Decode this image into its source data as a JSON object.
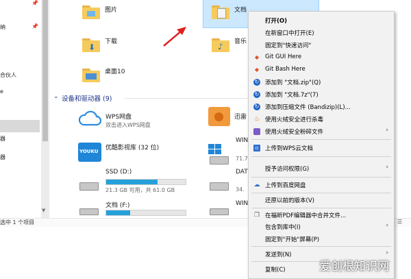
{
  "nav": {
    "items": [
      "纳",
      "合伙人",
      "e",
      "器",
      "器"
    ]
  },
  "content": {
    "folders": [
      "图片",
      "下载",
      "桌面10"
    ],
    "selected_file": "文档",
    "music_label": "音乐",
    "section_title": "设备和驱动器 (9)",
    "wps": {
      "name": "WPS网盘",
      "desc": "双击进入WPS网盘"
    },
    "youku": {
      "name": "优酷影视库 (32 位)",
      "logo": "YOUKU"
    },
    "xunlei": "迅雷",
    "ssd": {
      "name": "SSD (D:)",
      "free": "21.3 GB 可用，共 61.0 GB",
      "used_fraction": 0.65
    },
    "docs": {
      "name": "文档 (F:)",
      "used_fraction": 0.3
    },
    "right_cut": [
      "WIN",
      "71.7",
      "DAT",
      "34.",
      "WIN"
    ]
  },
  "status": {
    "text": "选中 1 个项目"
  },
  "menu": {
    "items": [
      {
        "label": "打开(O)",
        "bold": true
      },
      {
        "label": "在新窗口中打开(E)"
      },
      {
        "label": "固定到\"快速访问\""
      },
      {
        "label": "Git GUI Here",
        "icon": "git-gui-icon"
      },
      {
        "label": "Git Bash Here",
        "icon": "git-bash-icon"
      },
      {
        "label": "添加到 \"文档.zip\"(Q)",
        "icon": "bandizip-icon"
      },
      {
        "label": "添加到 \"文档.7z\"(7)",
        "icon": "bandizip-icon"
      },
      {
        "label": "添加到压缩文件 (Bandizip)(L)...",
        "icon": "bandizip-icon"
      },
      {
        "label": "使用火绒安全进行杀毒",
        "icon": "huorong-icon"
      },
      {
        "label": "使用火绒安全粉碎文件",
        "icon": "shredder-icon",
        "submenu": true
      },
      {
        "label": "上传到WPS云文档",
        "icon": "wps-cloud-icon"
      },
      {
        "label": "授予访问权限(G)",
        "submenu": true
      },
      {
        "label": "上传到百度网盘",
        "icon": "baidu-netdisk-icon"
      },
      {
        "label": "还原以前的版本(V)"
      },
      {
        "label": "在福昕PDF编辑器中合并文件...",
        "icon": "foxit-pdf-icon"
      },
      {
        "label": "包含到库中(I)",
        "submenu": true
      },
      {
        "label": "固定到\"开始\"屏幕(P)"
      },
      {
        "label": "发送到(N)",
        "submenu": true
      },
      {
        "label": "复制(C)"
      }
    ]
  },
  "watermark": "爱创根知识网",
  "colors": {
    "accent": "#26a0da",
    "selection": "#cce8ff",
    "arrow": "#e02020"
  }
}
